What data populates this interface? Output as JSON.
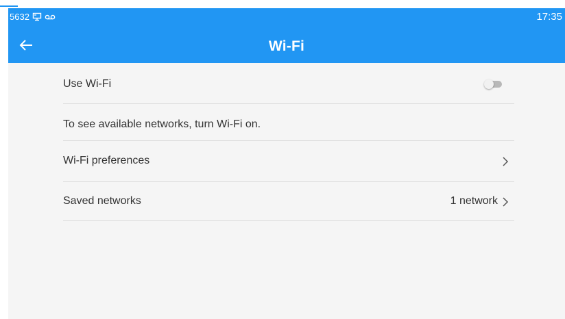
{
  "status_bar": {
    "left_text": "5632",
    "time": "17:35",
    "icons": [
      "screen-cast-icon",
      "voicemail-icon"
    ]
  },
  "app_bar": {
    "title": "Wi-Fi",
    "back_icon": "arrow-back-icon"
  },
  "settings": {
    "use_wifi": {
      "label": "Use Wi-Fi",
      "enabled": false
    },
    "info_text": "To see available networks, turn Wi-Fi on.",
    "preferences": {
      "label": "Wi-Fi preferences"
    },
    "saved_networks": {
      "label": "Saved networks",
      "summary": "1 network"
    }
  },
  "colors": {
    "primary": "#2196f3",
    "background": "#f5f5f5",
    "divider": "#dcdcdc",
    "text": "#333333"
  }
}
